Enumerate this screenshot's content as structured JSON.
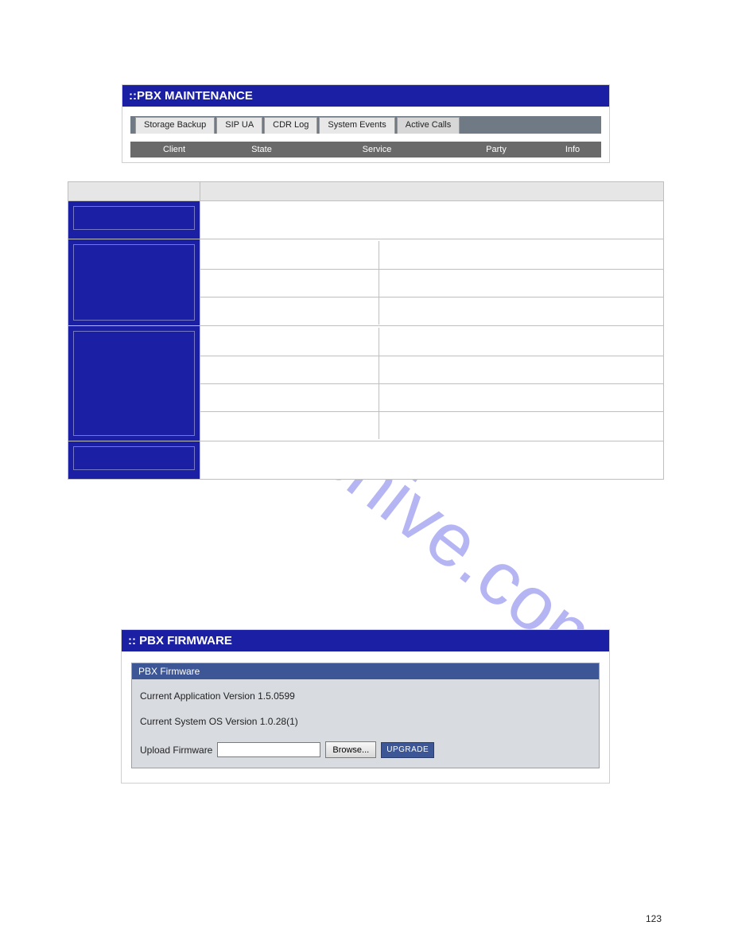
{
  "watermark": "manualshive.com",
  "maintenance": {
    "header": "::PBX MAINTENANCE",
    "tabs": [
      "Storage Backup",
      "SIP UA",
      "CDR Log",
      "System Events",
      "Active Calls"
    ],
    "active_tab_index": 4,
    "columns": [
      "Client",
      "State",
      "Service",
      "Party",
      "Info"
    ]
  },
  "firmware": {
    "header": ":: PBX FIRMWARE",
    "panel_title": "PBX Firmware",
    "app_version_line": "Current Application Version 1.5.0599",
    "os_version_line": "Current System OS Version 1.0.28(1)",
    "upload_label": "Upload Firmware",
    "browse_label": "Browse...",
    "upgrade_label": "UPGRADE"
  },
  "page_number": "123"
}
